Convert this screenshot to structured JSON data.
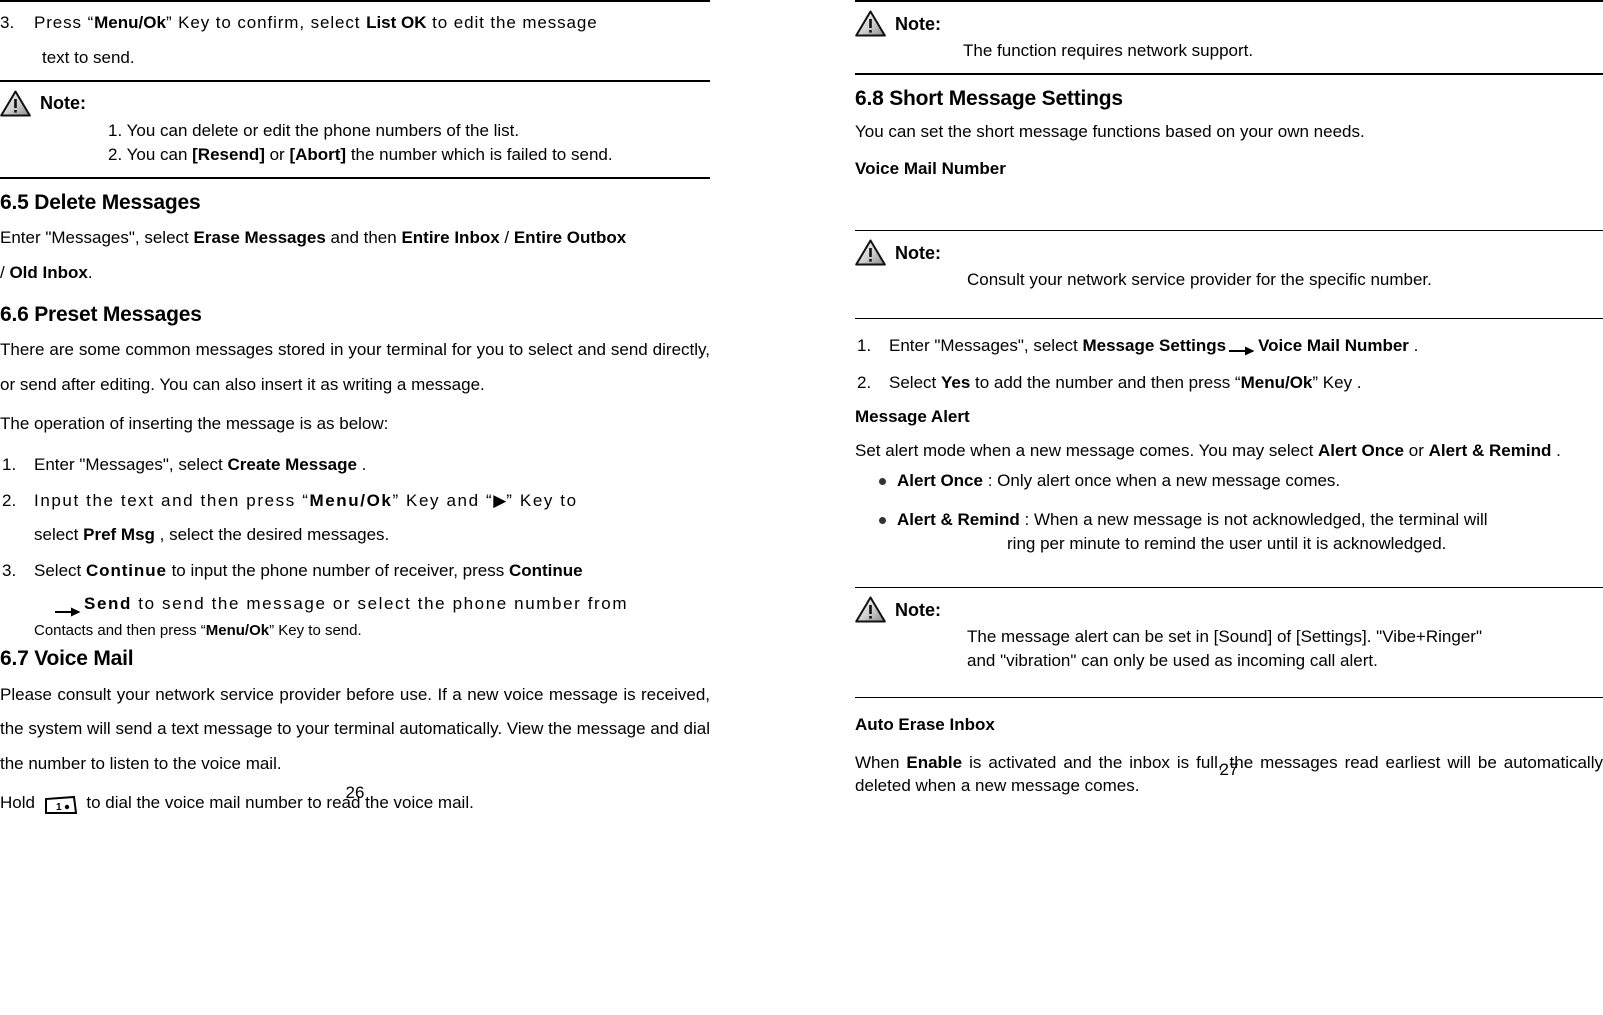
{
  "document": {
    "type": "user-manual-spread",
    "left_page_number": "26",
    "right_page_number": "27"
  },
  "left_page": {
    "step3": {
      "number": "3.",
      "part1": "Press “",
      "key1": "Menu/Ok",
      "part2": "” Key to confirm, select ",
      "key2": "List OK",
      "part3": " to edit the message",
      "line2": "text to send."
    },
    "note1": {
      "icon": "warning-triangle-icon",
      "label": "Note:",
      "item1": "1. You can delete or edit the phone numbers of the list.",
      "item2_pre": "2. You can ",
      "item2_b1": "[Resend]",
      "item2_mid": " or ",
      "item2_b2": "[Abort]",
      "item2_post": " the number which is failed to send."
    },
    "s65": {
      "heading": "6.5 Delete Messages",
      "p1_pre": "Enter \"Messages\", select ",
      "p1_b1": "Erase Messages",
      "p1_mid": " and then ",
      "p1_b2": "Entire Inbox",
      "p1_sep": " / ",
      "p1_b3": "Entire Outbox",
      "p2_sep": "/ ",
      "p2_b": "Old Inbox",
      "p2_post": "."
    },
    "s66": {
      "heading": "6.6 Preset Messages",
      "p1": "There are some common messages stored in your terminal for you to select and send directly, or send after editing. You can also insert it as writing a message.",
      "p2": "The operation of inserting the message is as below:",
      "steps": [
        {
          "pre": "Enter \"Messages\", select ",
          "bold": "Create Message",
          "post": " ."
        },
        {
          "pre": "Input the text and then press “",
          "bold": "Menu/Ok",
          "mid": "” Key and “",
          "arrow": "▶",
          "mid2": "” Key to",
          "line2_pre": "select ",
          "line2_bold": "Pref Msg",
          "line2_post": " , select the desired messages."
        },
        {
          "pre": "Select ",
          "bold1": "Continue",
          "mid": " to input the phone number of receiver, press ",
          "bold2": "Continue",
          "arrow_icon": "right-arrow-icon",
          "bold3": "Send",
          "mid2": " to send the message or select the phone number from",
          "line3_pre": "Contacts and then press “",
          "line3_bold": "Menu/Ok",
          "line3_post": "” Key to send."
        }
      ]
    },
    "s67": {
      "heading": "6.7 Voice Mail",
      "p1": "Please consult your network service provider before use. If a new voice message is received, the system will send a text message to your terminal automatically. View the message and dial the number to listen to the voice mail.",
      "p2_pre": "Hold ",
      "key_icon": "keypad-key-1-icon",
      "key_label": "1",
      "p2_post": " to dial the voice mail number to read the voice mail."
    }
  },
  "right_page": {
    "note_top": {
      "icon": "warning-triangle-icon",
      "label": "Note:",
      "text": "The function requires network support."
    },
    "s68": {
      "heading": "6.8 Short Message Settings",
      "intro": "You can set the short message functions based on your own needs.",
      "sub1": "Voice Mail Number"
    },
    "note_vmn": {
      "icon": "warning-triangle-icon",
      "label": "Note:",
      "text": "Consult your network service provider for the specific number."
    },
    "vmn_steps": [
      {
        "pre": "Enter \"Messages\", select ",
        "bold1": "Message Settings",
        "arrow_icon": "right-arrow-icon",
        "bold2": "Voice Mail Number",
        "post": " ."
      },
      {
        "pre": "Select ",
        "bold1": "Yes",
        "mid": " to add the number and then press “",
        "bold2": "Menu/Ok",
        "post": "” Key ."
      }
    ],
    "message_alert": {
      "sub_heading": "Message Alert",
      "p_pre": "Set alert mode when a new message comes. You may select ",
      "p_b1": "Alert Once",
      "p_mid": " or ",
      "p_b2": "Alert & Remind",
      "p_post": " .",
      "bullets": [
        {
          "term": "Alert Once",
          "text": " : Only alert once when a new message comes."
        },
        {
          "term": "Alert & Remind",
          "text": " : When a new message is not acknowledged, the terminal will",
          "text2": "ring per minute to remind the user until it is acknowledged."
        }
      ]
    },
    "note_alert": {
      "icon": "warning-triangle-icon",
      "label": "Note:",
      "line1": "The message alert can be set in [Sound] of [Settings]. \"Vibe+Ringer\"",
      "line2": "and \"vibration\" can only be used as incoming call alert."
    },
    "auto_erase": {
      "sub_heading": "Auto Erase Inbox",
      "p_pre": "When ",
      "p_bold": "Enable",
      "p_post": " is activated and the inbox is full, the messages read earliest will be automatically deleted when a new message comes."
    }
  }
}
